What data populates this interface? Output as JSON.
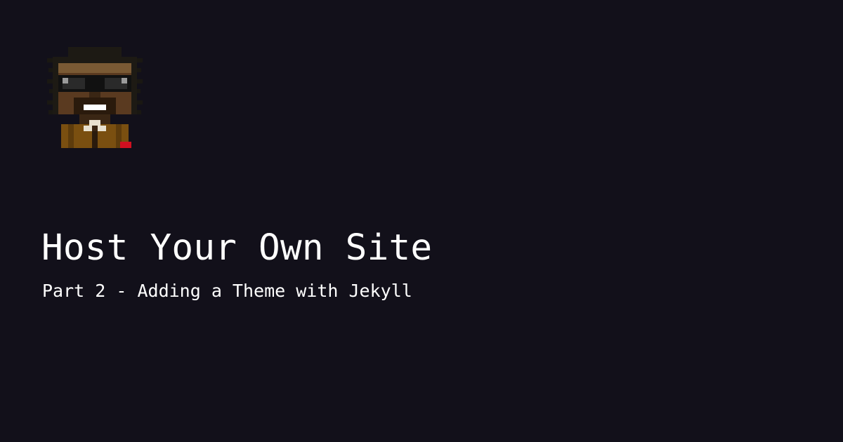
{
  "avatar": {
    "icon": "pixel-art-avatar-icon",
    "colors": {
      "hat": "#1d1a14",
      "hat_band": "#7a5a34",
      "skin": "#5a3a20",
      "shadow": "#3a2614",
      "glasses": "#111111",
      "glasses_shine": "#9a9a9a",
      "teeth": "#ffffff",
      "jacket": "#7a4f10",
      "collar": "#e8e1d0",
      "badge": "#d01020"
    }
  },
  "card": {
    "title": "Host Your Own Site",
    "subtitle": "Part 2 - Adding a Theme with Jekyll"
  },
  "colors": {
    "background": "#12101a",
    "text": "#ffffff"
  }
}
